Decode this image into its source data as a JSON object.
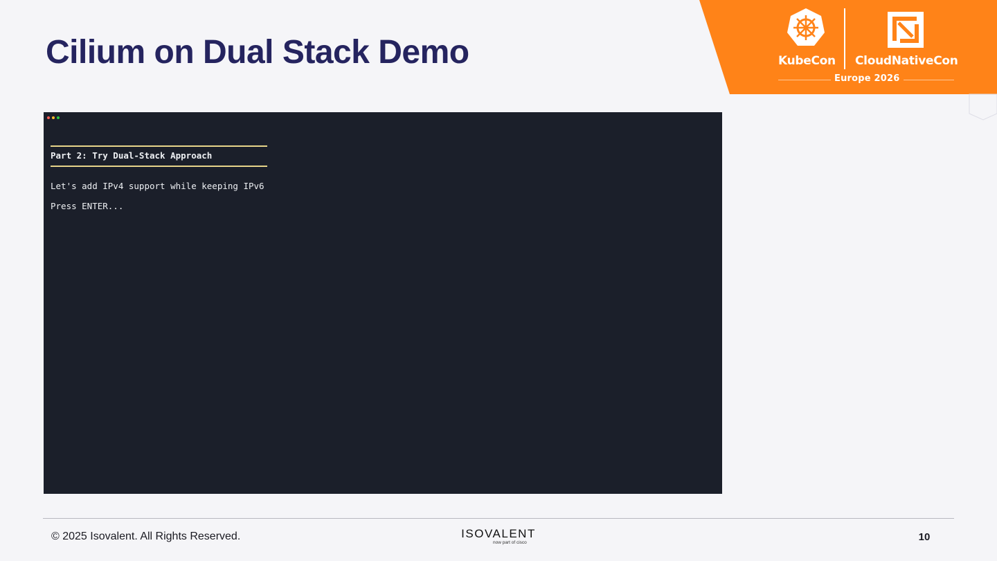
{
  "slide": {
    "title": "Cilium on Dual Stack Demo",
    "page_number": "10"
  },
  "conference": {
    "left_name": "KubeCon",
    "right_name": "CloudNativeCon",
    "edition": "Europe 2026",
    "accent_color": "#ff8318"
  },
  "terminal": {
    "background_color": "#1b1f2a",
    "rule_color": "#e8d58a",
    "heading": "Part 2: Try Dual-Stack Approach",
    "message": "Let's add IPv4 support while keeping IPv6",
    "prompt": "Press ENTER..."
  },
  "footer": {
    "copyright": "© 2025 Isovalent. All Rights Reserved.",
    "logo_text": "ISOVALENT",
    "logo_tagline": "now part of cisco"
  },
  "icons": {
    "kubecon": "kubernetes-helm-wheel-icon",
    "cncf": "cncf-logo-icon",
    "window_controls": [
      "close-dot-icon",
      "minimize-dot-icon",
      "maximize-dot-icon"
    ]
  }
}
